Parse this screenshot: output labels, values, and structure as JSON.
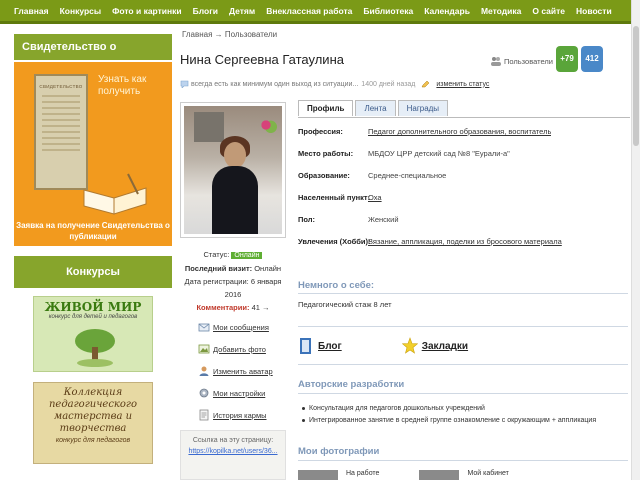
{
  "nav": {
    "items": [
      "Главная",
      "Конкурсы",
      "Фото и картинки",
      "Блоги",
      "Детям",
      "Внеклассная работа",
      "Библиотека",
      "Календарь",
      "Методика",
      "О сайте",
      "Новости"
    ]
  },
  "sidebar": {
    "certificate_header": "Свидетельство о публикации",
    "cert_doc_title": "СВИДЕТЕЛЬСТВО",
    "cert_know": "Узнать как получить",
    "cert_caption": "Заявка на получение Свидетельства о публикации",
    "contests_header": "Конкурсы",
    "promo1_title": "ЖИВОЙ МИР",
    "promo1_sub": "конкурс для детей и педагогов",
    "promo2_title": "Коллекция педагогического мастерства и творчества",
    "promo2_sub": "конкурс для педагогов"
  },
  "profile": {
    "breadcrumb": "Главная → Пользователи",
    "name": "Нина Сергеевна Гатаулина",
    "people_link": "Пользователи",
    "badge_green": "+79",
    "badge_blue": "412",
    "status_prefix": "всегда есть как минимум один выход из ситуации...",
    "status_dim": "1400 дней назад",
    "status_change": "изменить статус",
    "status_label": "Статус:",
    "status_value": "Онлайн",
    "last_visit_label": "Последний визит:",
    "last_visit_value": "Онлайн",
    "registered": "Дата регистрации: 6 января 2016",
    "comments_label": "Комментарии:",
    "comments_value": "41 →"
  },
  "user_menu": [
    {
      "label": "Мои сообщения",
      "icon": "envelope-icon"
    },
    {
      "label": "Добавить фото",
      "icon": "photo-icon"
    },
    {
      "label": "Изменить аватар",
      "icon": "avatar-icon"
    },
    {
      "label": "Мои настройки",
      "icon": "settings-icon"
    },
    {
      "label": "История кармы",
      "icon": "karma-icon"
    }
  ],
  "link_box": {
    "label": "Ссылка на эту страницу:",
    "url": "https://kopilka.net/users/36..."
  },
  "tabs": [
    "Профиль",
    "Лента",
    "Награды"
  ],
  "fields": [
    {
      "key": "Профессия:",
      "value": "Педагог дополнительного образования, воспитатель",
      "link": true
    },
    {
      "key": "Место работы:",
      "value": "МБДОУ ЦРР детский сад №8 \"Еурали-а\"",
      "link": false
    },
    {
      "key": "Образование:",
      "value": "Среднее-специальное",
      "link": false
    },
    {
      "key": "Населенный пункт:",
      "value": "Оха",
      "link": true
    },
    {
      "key": "Пол:",
      "value": "Женский",
      "link": false
    },
    {
      "key": "Увлечения (Хобби):",
      "value": "Вязание, аппликация, поделки из бросового материала",
      "link": true
    }
  ],
  "about": {
    "title": "Немного о себе:",
    "text": "Педагогический стаж 8 лет"
  },
  "quick_links": {
    "blog": "Блог",
    "bookmarks": "Закладки"
  },
  "developments": {
    "title": "Авторские разработки",
    "items": [
      "Консультация для педагогов дошкольных учреждений",
      "Интегрированное занятие в средней группе ознакомление с окружающим + аппликация"
    ]
  },
  "photos": {
    "title": "Мои фотографии",
    "items": [
      "На работе",
      "Мой кабинет"
    ]
  },
  "colors": {
    "nav_green": "#7b9a17",
    "sidebar_green": "#87a52c",
    "cert_orange": "#f29a1e",
    "badge_green": "#5aa53a",
    "badge_blue": "#4a88c8"
  }
}
